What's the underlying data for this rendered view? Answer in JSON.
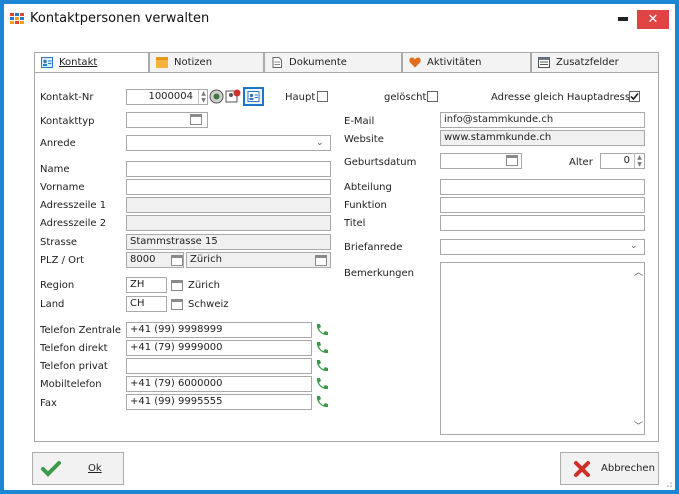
{
  "window": {
    "title": "Kontaktpersonen verwalten",
    "close_glyph": "✕"
  },
  "tabs": [
    {
      "label": "Kontakt",
      "icon": "contact-card-icon",
      "active": true
    },
    {
      "label": "Notizen",
      "icon": "sticky-note-icon"
    },
    {
      "label": "Dokumente",
      "icon": "document-icon"
    },
    {
      "label": "Aktivitäten",
      "icon": "heart-icon"
    },
    {
      "label": "Zusatzfelder",
      "icon": "extra-fields-icon"
    }
  ],
  "left": {
    "kontakt_nr_label": "Kontakt-Nr",
    "kontakt_nr_value": "1000004",
    "haupt_label": "Haupt",
    "kontakttyp_label": "Kontakttyp",
    "anrede_label": "Anrede",
    "name_label": "Name",
    "vorname_label": "Vorname",
    "adress1_label": "Adresszeile 1",
    "adress2_label": "Adresszeile 2",
    "strasse_label": "Strasse",
    "strasse_value": "Stammstrasse 15",
    "plz_label": "PLZ / Ort",
    "plz_value": "8000",
    "ort_value": "Zürich",
    "region_label": "Region",
    "region_code": "ZH",
    "region_name": "Zürich",
    "land_label": "Land",
    "land_code": "CH",
    "land_name": "Schweiz",
    "phones": [
      {
        "label": "Telefon Zentrale",
        "value": "+41 (99) 9998999"
      },
      {
        "label": "Telefon direkt",
        "value": "+41 (79) 9999000"
      },
      {
        "label": "Telefon privat",
        "value": ""
      },
      {
        "label": "Mobiltelefon",
        "value": "+41 (79) 6000000"
      },
      {
        "label": "Fax",
        "value": "+41 (99) 9995555"
      }
    ]
  },
  "right": {
    "geloescht_label": "gelöscht",
    "adresse_label": "Adresse gleich Hauptadresse",
    "email_label": "E-Mail",
    "email_value": "info@stammkunde.ch",
    "website_label": "Website",
    "website_value": "www.stammkunde.ch",
    "geburtsdatum_label": "Geburtsdatum",
    "alter_label": "Alter",
    "alter_value": "0",
    "abteilung_label": "Abteilung",
    "funktion_label": "Funktion",
    "titel_label": "Titel",
    "briefanrede_label": "Briefanrede",
    "bemerkungen_label": "Bemerkungen"
  },
  "buttons": {
    "ok_label": "Ok",
    "cancel_label": "Abbrechen"
  },
  "colors": {
    "accent": "#1b86d4",
    "focus": "#1e74c8",
    "close": "#e04343",
    "phone": "#3c9a4a"
  }
}
